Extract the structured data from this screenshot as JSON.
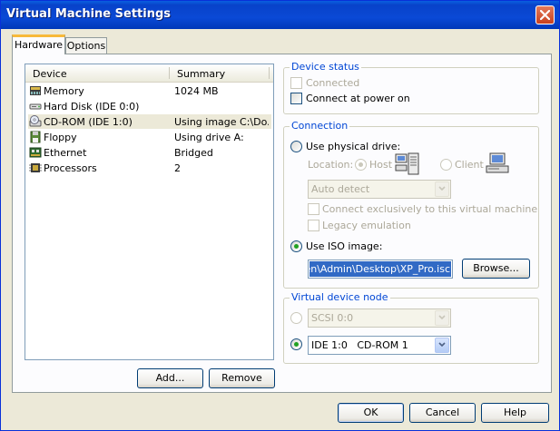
{
  "window": {
    "title": "Virtual Machine Settings"
  },
  "tabs": [
    {
      "label": "Hardware",
      "active": true
    },
    {
      "label": "Options",
      "active": false
    }
  ],
  "device_list": {
    "columns": [
      "Device",
      "Summary"
    ],
    "rows": [
      {
        "icon": "memory-icon",
        "device": "Memory",
        "summary": "1024 MB",
        "selected": false
      },
      {
        "icon": "hard-disk-icon",
        "device": "Hard Disk (IDE 0:0)",
        "summary": "",
        "selected": false
      },
      {
        "icon": "cd-rom-icon",
        "device": "CD-ROM (IDE 1:0)",
        "summary": "Using image C:\\Do...",
        "selected": true
      },
      {
        "icon": "floppy-icon",
        "device": "Floppy",
        "summary": "Using drive A:",
        "selected": false
      },
      {
        "icon": "ethernet-icon",
        "device": "Ethernet",
        "summary": "Bridged",
        "selected": false
      },
      {
        "icon": "processor-icon",
        "device": "Processors",
        "summary": "2",
        "selected": false
      }
    ],
    "add_button": "Add...",
    "remove_button": "Remove"
  },
  "device_status": {
    "label": "Device status",
    "connected": {
      "label": "Connected",
      "checked": false,
      "enabled": false
    },
    "connect_at_power_on": {
      "label": "Connect at power on",
      "checked": false,
      "enabled": true
    }
  },
  "connection": {
    "label": "Connection",
    "use_physical_drive": {
      "label": "Use physical drive:",
      "selected": false
    },
    "location_label": "Location:",
    "host": {
      "label": "Host",
      "selected": true,
      "enabled": false
    },
    "client": {
      "label": "Client",
      "selected": false,
      "enabled": false
    },
    "drive_select": {
      "value": "Auto detect",
      "enabled": false
    },
    "connect_exclusively": {
      "label": "Connect exclusively to this virtual machine",
      "checked": false,
      "enabled": false
    },
    "legacy_emulation": {
      "label": "Legacy emulation",
      "checked": false,
      "enabled": false
    },
    "use_iso_image": {
      "label": "Use ISO image:",
      "selected": true
    },
    "iso_path": "C:\\Documents and Settings\\Admin\\Desktop\\XP_Pro.iso",
    "iso_path_visible": "gen\\Admin\\Desktop\\XP_Pro.isc",
    "browse_button": "Browse..."
  },
  "virtual_device_node": {
    "label": "Virtual device node",
    "scsi": {
      "value": "SCSI 0:0",
      "selected": false,
      "enabled": false
    },
    "ide": {
      "value": "IDE 1:0   CD-ROM 1",
      "selected": true,
      "enabled": true
    }
  },
  "footer": {
    "ok_button": "OK",
    "cancel_button": "Cancel",
    "help_button": "Help"
  },
  "colors": {
    "titlebar": "#0a4ad6",
    "dialog_bg": "#ece9d8",
    "group_label": "#0046d5",
    "selection": "#316ac5",
    "radio_dot": "#21a121",
    "active_tab_accent": "#f7b93a"
  }
}
